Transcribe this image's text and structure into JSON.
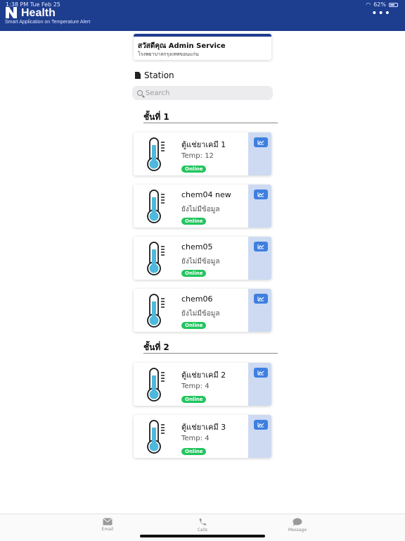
{
  "status_bar": {
    "time": "1:38 PM   Tue Feb 25",
    "battery": "62%"
  },
  "header": {
    "title": "Health",
    "subtitle": "Smart Application on Temperature Alert"
  },
  "greeting": {
    "title": "สวัสดีคุณ Admin Service",
    "hospital": "โรงพยาบาลกรุงเทพขอนแก่น"
  },
  "section_title": "Station",
  "search": {
    "placeholder": "Search",
    "value": ""
  },
  "floors": [
    {
      "label": "ชั้นที่ 1",
      "stations": [
        {
          "name": "ตู้แช่ยาเคมี 1",
          "reading": "Temp: 12",
          "status": "Online"
        },
        {
          "name": "chem04 new",
          "reading": "ยังไม่มีข้อมูล",
          "status": "Online"
        },
        {
          "name": "chem05",
          "reading": "ยังไม่มีข้อมูล",
          "status": "Online"
        },
        {
          "name": "chem06",
          "reading": "ยังไม่มีข้อมูล",
          "status": "Online"
        }
      ]
    },
    {
      "label": "ชั้นที่ 2",
      "stations": [
        {
          "name": "ตู้แช่ยาเคมี 2",
          "reading": "Temp: 4",
          "status": "Online"
        },
        {
          "name": "ตู้แช่ยาเคมี 3",
          "reading": "Temp: 4",
          "status": "Online"
        }
      ]
    }
  ],
  "tabs": [
    {
      "label": "Email",
      "icon": "mail-icon"
    },
    {
      "label": "Calls",
      "icon": "phone-icon"
    },
    {
      "label": "Message",
      "icon": "chat-icon"
    }
  ],
  "colors": {
    "header": "#1d3d8f",
    "online": "#22c55e",
    "chart_button": "#3f7fe0",
    "card_side": "#cddaf2"
  }
}
